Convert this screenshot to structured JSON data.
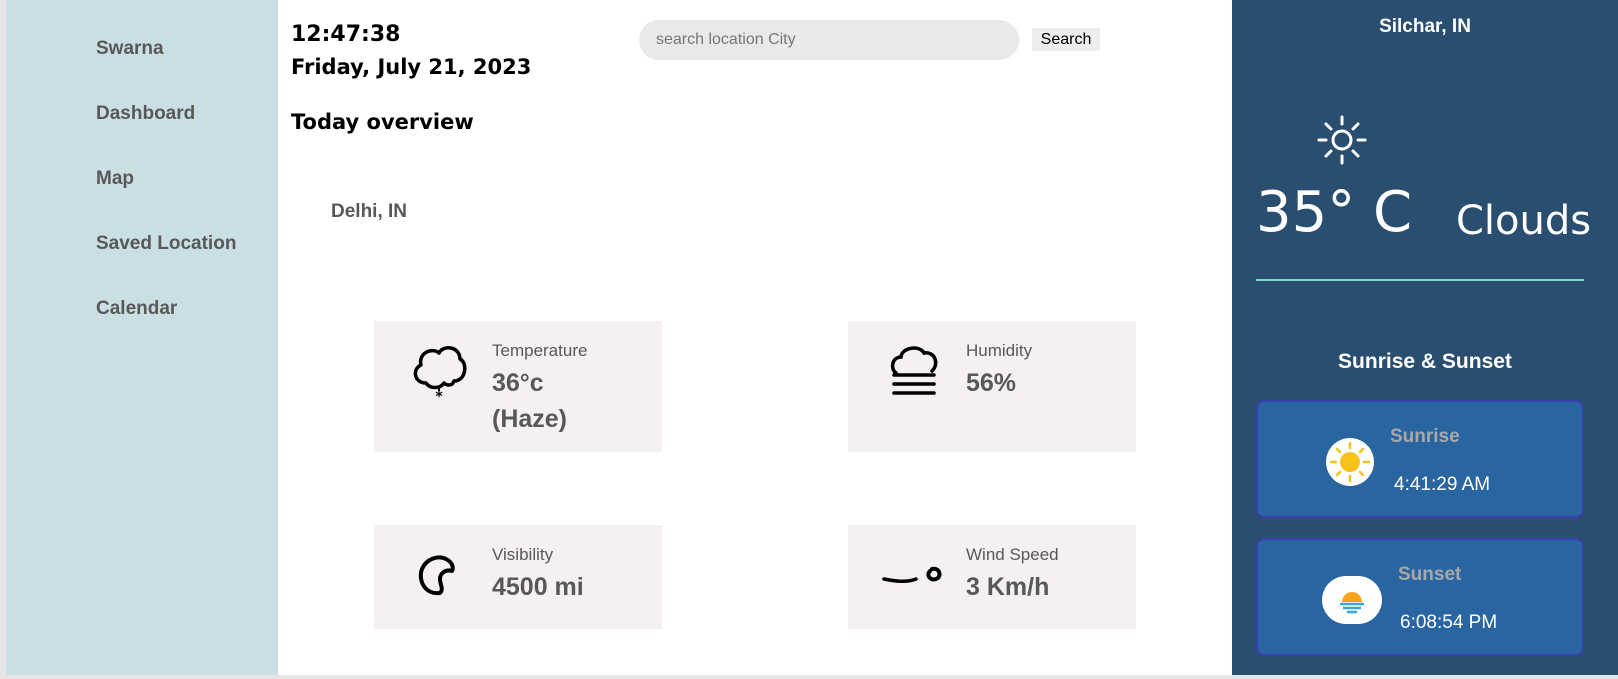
{
  "sidebar": {
    "items": [
      {
        "label": "Swarna"
      },
      {
        "label": "Dashboard"
      },
      {
        "label": "Map"
      },
      {
        "label": "Saved Location"
      },
      {
        "label": "Calendar"
      }
    ]
  },
  "header": {
    "time": "12:47:38",
    "date": "Friday, July 21, 2023",
    "overview_title": "Today overview"
  },
  "search": {
    "placeholder": "search location City",
    "value": "",
    "button_label": "Search"
  },
  "overview": {
    "location": "Delhi, IN",
    "cards": [
      {
        "label": "Temperature",
        "value": "36°c",
        "value2": "(Haze)",
        "icon": "cloud-snow-icon"
      },
      {
        "label": "Humidity",
        "value": "56%",
        "icon": "fog-icon"
      },
      {
        "label": "Visibility",
        "value": "4500 mi",
        "icon": "moon-icon"
      },
      {
        "label": "Wind Speed",
        "value": "3 Km/h",
        "icon": "wind-icon"
      }
    ]
  },
  "right_panel": {
    "city": "Silchar, IN",
    "temperature": "35° C",
    "condition": "Clouds",
    "weather_icon": "sun-icon",
    "sun_title": "Sunrise & Sunset",
    "sunrise_label": "Sunrise",
    "sunrise_time": "4:41:29 AM",
    "sunset_label": "Sunset",
    "sunset_time": "6:08:54 PM"
  },
  "colors": {
    "sidebar_bg": "#c9dfe4",
    "right_panel_bg": "#2a4e6f",
    "sun_card_bg": "#2966a1",
    "card_bg": "#f4f1f0",
    "divider": "#7fd4c8"
  }
}
